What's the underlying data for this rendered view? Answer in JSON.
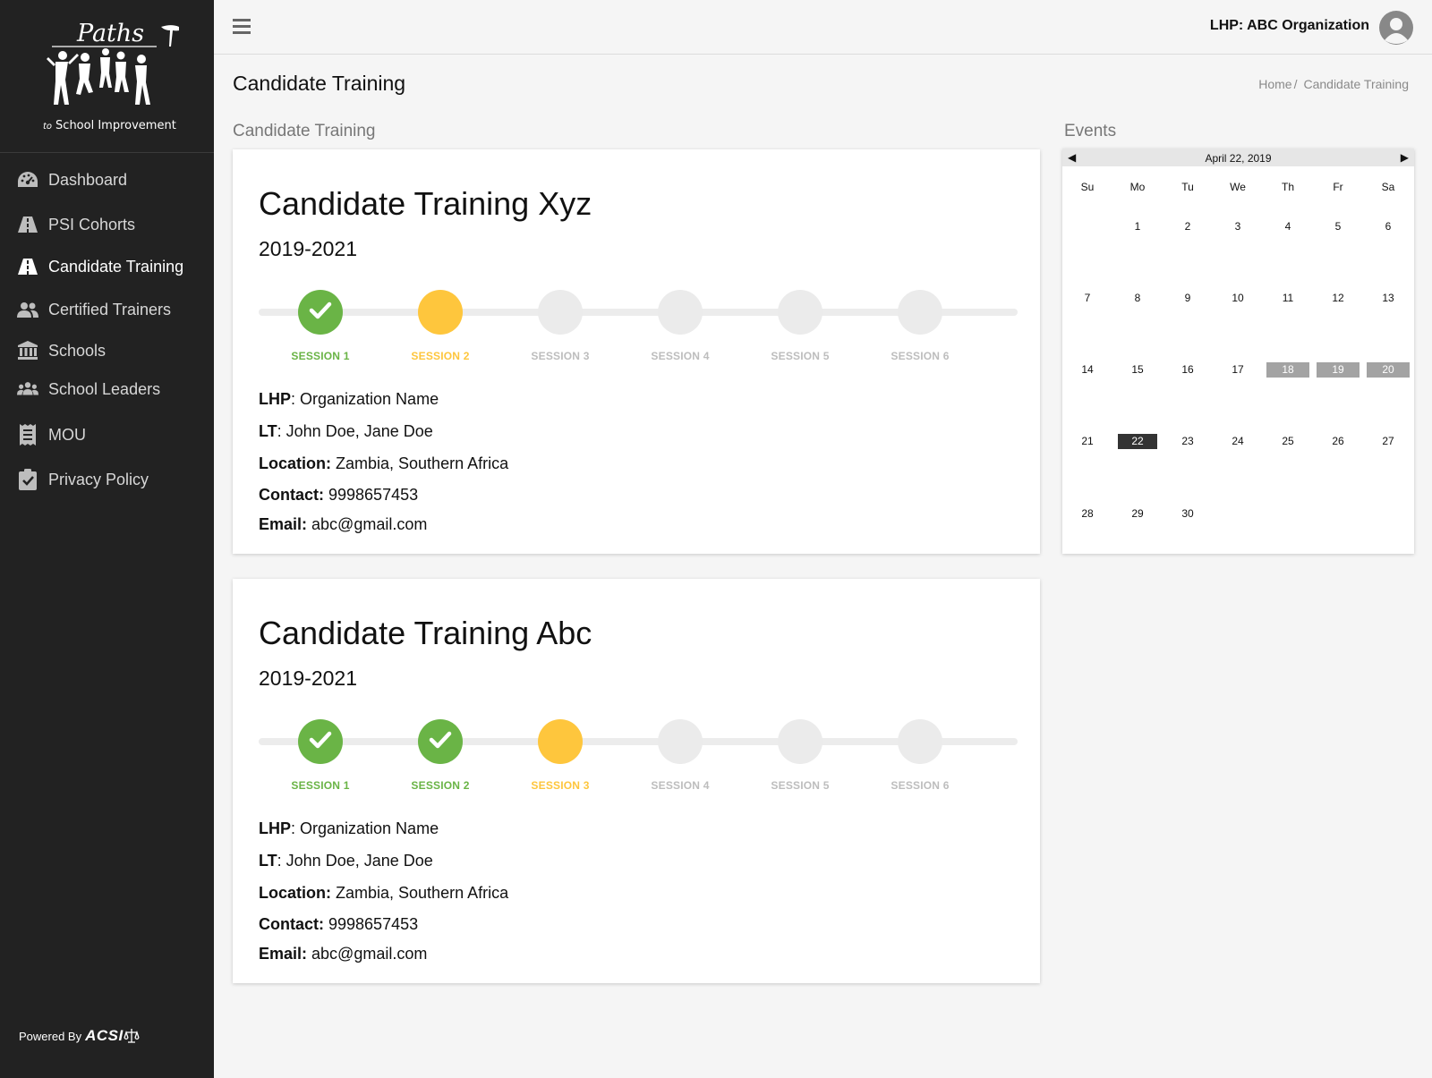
{
  "brand": {
    "logo_script": "Paths",
    "logo_tagline_prefix": "to",
    "logo_tagline": "School Improvement",
    "powered_by": "Powered By",
    "powered_brand": "ACSI"
  },
  "sidebar": {
    "items": [
      {
        "label": "Dashboard",
        "icon": "dashboard-icon"
      },
      {
        "label": "PSI Cohorts",
        "icon": "road-icon"
      },
      {
        "label": "Candidate Training",
        "icon": "road-icon",
        "active": true
      },
      {
        "label": "Certified Trainers",
        "icon": "users-icon"
      },
      {
        "label": "Schools",
        "icon": "school-building-icon"
      },
      {
        "label": "School Leaders",
        "icon": "group-icon"
      },
      {
        "label": "MOU",
        "icon": "receipt-icon"
      },
      {
        "label": "Privacy Policy",
        "icon": "clipboard-check-icon"
      }
    ]
  },
  "header": {
    "user": "LHP: ABC Organization",
    "page_title": "Candidate Training",
    "breadcrumb": [
      "Home",
      "/",
      "Candidate Training"
    ]
  },
  "main": {
    "section_label": "Candidate Training",
    "events_label": "Events",
    "cards": [
      {
        "title": "Candidate Training Xyz",
        "year": "2019-2021",
        "sessions": [
          {
            "label": "SESSION 1",
            "status": "done"
          },
          {
            "label": "SESSION 2",
            "status": "current"
          },
          {
            "label": "SESSION 3",
            "status": "todo"
          },
          {
            "label": "SESSION 4",
            "status": "todo"
          },
          {
            "label": "SESSION 5",
            "status": "todo"
          },
          {
            "label": "SESSION 6",
            "status": "todo"
          }
        ],
        "lhp_label": "LHP",
        "lhp": ": Organization Name",
        "lt_label": "LT",
        "lt": ": John Doe, Jane Doe",
        "location_label": "Location:",
        "location": " Zambia, Southern Africa",
        "contact_label": "Contact:",
        "contact": " 9998657453",
        "email_label": "Email:",
        "email": " abc@gmail.com"
      },
      {
        "title": "Candidate Training Abc",
        "year": "2019-2021",
        "sessions": [
          {
            "label": "SESSION 1",
            "status": "done"
          },
          {
            "label": "SESSION 2",
            "status": "done"
          },
          {
            "label": "SESSION 3",
            "status": "current"
          },
          {
            "label": "SESSION 4",
            "status": "todo"
          },
          {
            "label": "SESSION 5",
            "status": "todo"
          },
          {
            "label": "SESSION 6",
            "status": "todo"
          }
        ],
        "lhp_label": "LHP",
        "lhp": ": Organization Name",
        "lt_label": "LT",
        "lt": ": John Doe, Jane Doe",
        "location_label": "Location:",
        "location": " Zambia, Southern Africa",
        "contact_label": "Contact:",
        "contact": " 9998657453",
        "email_label": "Email:",
        "email": " abc@gmail.com"
      }
    ]
  },
  "calendar": {
    "title": "April 22, 2019",
    "prev": "◀",
    "next": "▶",
    "dow": [
      "Su",
      "Mo",
      "Tu",
      "We",
      "Th",
      "Fr",
      "Sa"
    ],
    "weeks": [
      [
        "",
        "1",
        "2",
        "3",
        "4",
        "5",
        "6"
      ],
      [
        "7",
        "8",
        "9",
        "10",
        "11",
        "12",
        "13"
      ],
      [
        "14",
        "15",
        "16",
        "17",
        "18",
        "19",
        "20"
      ],
      [
        "21",
        "22",
        "23",
        "24",
        "25",
        "26",
        "27"
      ],
      [
        "28",
        "29",
        "30",
        "",
        "",
        "",
        ""
      ]
    ],
    "event_days": [
      "18",
      "19",
      "20"
    ],
    "today": "22"
  },
  "colors": {
    "sidebar_bg": "#222222",
    "done": "#6ab446",
    "current": "#fec63d",
    "todo": "#ebebeb",
    "event_day": "#a3a3a3",
    "today": "#333333"
  }
}
